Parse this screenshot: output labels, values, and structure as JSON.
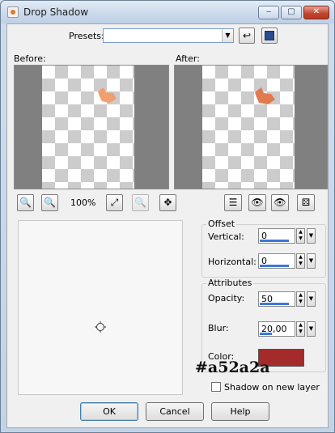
{
  "window": {
    "title": "Drop Shadow",
    "controls": {
      "minimize": "‒",
      "maximize": "▢",
      "close": "✕"
    }
  },
  "presets": {
    "label": "Presets:",
    "value": ""
  },
  "preview": {
    "before_label": "Before:",
    "after_label": "After:",
    "zoom": "100%"
  },
  "offset": {
    "title": "Offset",
    "vertical_label": "Vertical:",
    "vertical_value": "0",
    "horizontal_label": "Horizontal:",
    "horizontal_value": "0"
  },
  "attributes": {
    "title": "Attributes",
    "opacity_label": "Opacity:",
    "opacity_value": "50",
    "blur_label": "Blur:",
    "blur_value": "20,00",
    "color_label": "Color:",
    "color_hex": "#a52a2a",
    "color_text": "#a52a2a"
  },
  "shadow_on_new_layer": {
    "label": "Shadow on new layer",
    "checked": false
  },
  "buttons": {
    "ok": "OK",
    "cancel": "Cancel",
    "help": "Help"
  },
  "colors": {
    "swatch": "#a52a2a",
    "blob_before": "#f0a070",
    "blob_after": "#e07a4f"
  }
}
